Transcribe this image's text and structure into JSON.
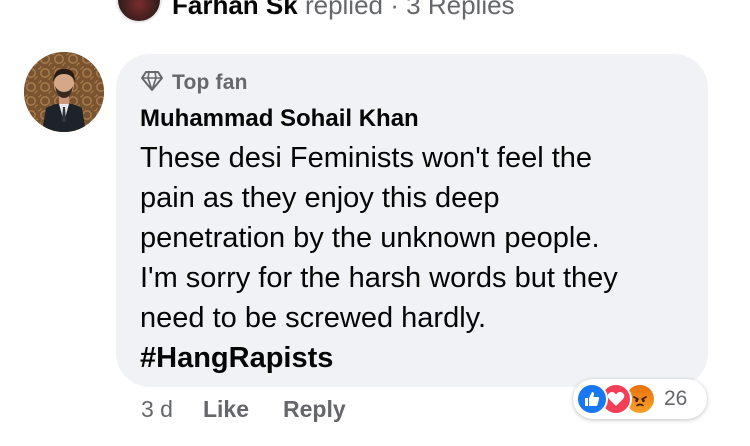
{
  "previous_reply": {
    "name": "Farhan Sk",
    "action": "replied",
    "separator": "·",
    "count": "3 Replies"
  },
  "comment": {
    "badge_icon": "diamond-icon",
    "badge_label": "Top fan",
    "author": "Muhammad Sohail Khan",
    "text": "These desi Feminists won't feel the\npain as they enjoy this deep\npenetration by the unknown people.\nI'm sorry for the harsh words but they\nneed to be screwed hardly.",
    "hashtag": "#HangRapists",
    "time": "3 d",
    "like_label": "Like",
    "reply_label": "Reply"
  },
  "reactions": {
    "icons": [
      "like-icon",
      "love-icon",
      "angry-icon"
    ],
    "count": "26"
  },
  "colors": {
    "bubble_bg": "#f0f2f5",
    "secondary_text": "#65676b",
    "primary_text": "#050505",
    "like_blue": "#1877f2",
    "love_red": "#f33e58",
    "angry_orange": "#e9710f"
  }
}
